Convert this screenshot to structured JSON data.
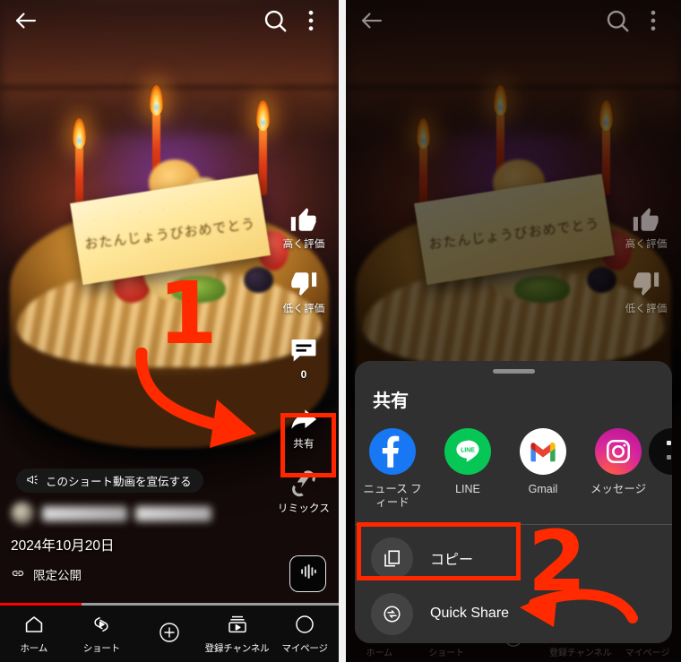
{
  "app": {
    "name": "YouTube Shorts",
    "locale": "ja-JP"
  },
  "left_panel": {
    "topbar": {
      "back_icon": "back-arrow-icon",
      "search_icon": "search-icon",
      "menu_icon": "kebab-menu-icon"
    },
    "video": {
      "description": "birthday cake with three lit candles and a yellow message plaque",
      "plaque_text": "おたんじょうびおめでとう"
    },
    "actions": [
      {
        "key": "like",
        "icon": "thumbs-up-icon",
        "label": "高く評価"
      },
      {
        "key": "dislike",
        "icon": "thumbs-down-icon",
        "label": "低く評価"
      },
      {
        "key": "comment",
        "icon": "comment-icon",
        "label": "",
        "count": "0"
      },
      {
        "key": "share",
        "icon": "share-arrow-icon",
        "label": "共有"
      },
      {
        "key": "remix",
        "icon": "remix-icon",
        "label": "リミックス"
      }
    ],
    "promo_pill": {
      "icon": "megaphone-icon",
      "label": "このショート動画を宣伝する"
    },
    "meta": {
      "channel_name_redacted": "",
      "video_title_redacted": "",
      "date": "2024年10月20日",
      "privacy_icon": "link-icon",
      "privacy_label": "限定公開"
    },
    "audio_button": {
      "icon": "sound-wave-icon"
    },
    "progress_percent": 24,
    "bottom_nav": [
      {
        "key": "home",
        "icon": "home-icon",
        "label": "ホーム",
        "active": true
      },
      {
        "key": "shorts",
        "icon": "shorts-icon",
        "label": "ショート",
        "active": false
      },
      {
        "key": "create",
        "icon": "plus-circle-icon",
        "label": "",
        "active": false
      },
      {
        "key": "subs",
        "icon": "subscriptions-icon",
        "label": "登録チャンネル",
        "active": false
      },
      {
        "key": "you",
        "icon": "account-icon",
        "label": "マイページ",
        "active": false
      }
    ],
    "annotation": {
      "step_number": "1",
      "arrow": "curved-arrow-down-right",
      "color": "#ff2a00"
    }
  },
  "right_panel": {
    "topbar": {
      "back_icon": "back-arrow-icon",
      "search_icon": "search-icon",
      "menu_icon": "kebab-menu-icon"
    },
    "actions": [
      {
        "key": "like",
        "icon": "thumbs-up-icon",
        "label": "高く評価"
      },
      {
        "key": "dislike",
        "icon": "thumbs-down-icon",
        "label": "低く評価"
      }
    ],
    "share_sheet": {
      "grabber": "drag-handle",
      "title": "共有",
      "apps": [
        {
          "key": "facebook",
          "icon": "facebook-icon",
          "label": "ニュース フィード",
          "color": "#1877F2"
        },
        {
          "key": "line",
          "icon": "line-icon",
          "label": "LINE",
          "color": "#06C755"
        },
        {
          "key": "gmail",
          "icon": "gmail-icon",
          "label": "Gmail",
          "color": "#FFFFFF"
        },
        {
          "key": "messages",
          "icon": "instagram-icon",
          "label": "メッセージ",
          "color": "#E1306C"
        }
      ],
      "list": [
        {
          "key": "copy",
          "icon": "copy-icon",
          "label": "コピー"
        },
        {
          "key": "quick_share",
          "icon": "quick-share-icon",
          "label": "Quick Share"
        }
      ]
    },
    "annotation": {
      "step_number": "2",
      "arrow": "curved-arrow-left",
      "color": "#ff2a00"
    }
  },
  "highlights": {
    "share_button_box_color": "#ff2600",
    "copy_row_box_color": "#ff2600"
  }
}
